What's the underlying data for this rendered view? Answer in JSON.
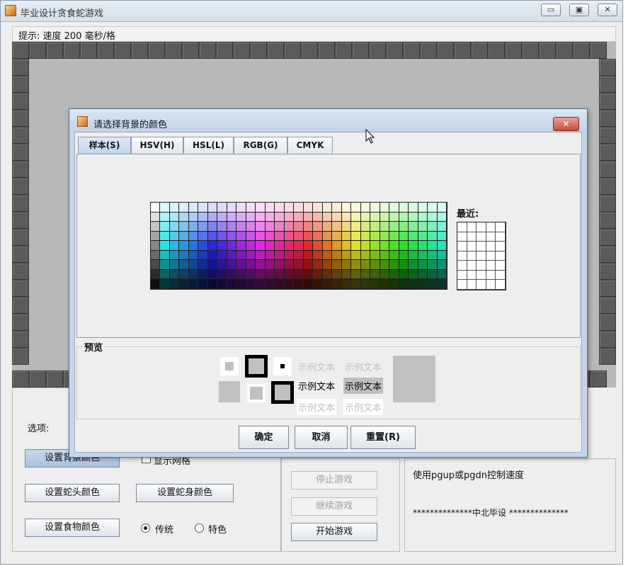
{
  "window": {
    "title": "毕业设计贪食蛇游戏",
    "minimize": "▭",
    "maximize": "▣",
    "close": "✕"
  },
  "hint": "提示: 速度 200 毫秒/格",
  "controls": {
    "options_label": "选项:",
    "set_bg_color": "设置背景颜色",
    "show_grid": "显示网格",
    "set_head_color": "设置蛇头颜色",
    "set_body_color": "设置蛇身颜色",
    "set_food_color": "设置食物颜色",
    "radio_traditional": "传统",
    "radio_special": "特色",
    "stop_game": "停止游戏",
    "continue_game": "继续游戏",
    "start_game": "开始游戏",
    "speed_tip": "使用pgup或pgdn控制速度",
    "footer": "**************中北毕设 **************"
  },
  "dialog": {
    "title": "请选择背景的颜色",
    "close": "✕",
    "tabs": [
      "样本(S)",
      "HSV(H)",
      "HSL(L)",
      "RGB(G)",
      "CMYK"
    ],
    "recent_label": "最近:",
    "preview_label": "预览",
    "sample_text": "示例文本",
    "buttons": {
      "ok": "确定",
      "cancel": "取消",
      "reset": "重置(R)"
    }
  },
  "colors": {
    "titlebar": "#d6dfea",
    "board": "#b8b8b8",
    "brick": "#5b5b5b",
    "dialog_frame": "#c6d6ea",
    "preview_gray": "#c0c0c0"
  }
}
